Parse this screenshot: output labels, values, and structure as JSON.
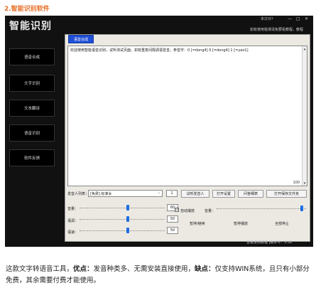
{
  "article": {
    "heading": "2.智能识别软件",
    "description": {
      "intro": "这款文字转语音工具，",
      "pros_label": "优点：",
      "pros": "发音种类多、无需安装直接使用，",
      "cons_label": "缺点：",
      "cons": "仅支持WIN系统，且只有小部分免费，其余需要付费才能使用。"
    }
  },
  "app": {
    "title": "智能识别",
    "user": "未次对?",
    "window_controls": {
      "minimize": "—",
      "maximize": "□",
      "close": "✕"
    },
    "notice": "如有使用错误清免要看教程，教程",
    "sidebar": [
      "语音合成",
      "文字识别",
      "文本翻译",
      "语音识别",
      "软件反馈"
    ],
    "tab_label": "语音合成",
    "text_content": "欢迎使用智能语音识别，试听测试页面，如有重复间隔调语音音，参音字：0 [=dong4] 0 [=dong4] 1 [=yao1]",
    "zoom_value": "100",
    "speaker_label": "发音人列表：",
    "speaker_value": "[免费] 标准女",
    "speaker_count": "1",
    "buttons": {
      "test_speaker": "试听发音人",
      "open_settings": "打开设置",
      "tutorial": "问答细表",
      "open_save_folder": "打开保存文件夹",
      "pause_resume": "暂停/继续",
      "pause_playback": "暂停播放",
      "stop_all": "全部停止"
    },
    "volume_label": "音量：",
    "volume_value": "60",
    "speed_label": "语速：",
    "speed_value": "50",
    "pitch_label": "语调：",
    "pitch_value": "50",
    "auto_play_label": "自动播放",
    "auto_play_checked": "☑",
    "right_volume_label": "音量：",
    "footer": "查看使用教程 |版本号：3.32"
  }
}
